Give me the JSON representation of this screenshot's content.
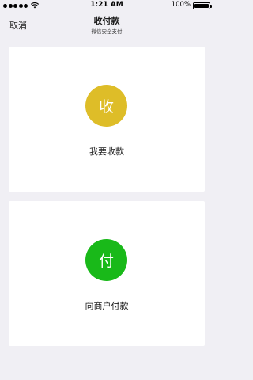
{
  "status_bar": {
    "time": "1:21 AM",
    "battery": "100%",
    "icons": [
      "signal-dots-icon",
      "wifi-icon",
      "battery-icon"
    ]
  },
  "nav": {
    "cancel_label": "取消",
    "title": "收付款",
    "subtitle": "微信安全支付"
  },
  "actions": [
    {
      "glyph": "收",
      "label": "我要收款",
      "color": "#debd28"
    },
    {
      "glyph": "付",
      "label": "向商户付款",
      "color": "#19b919"
    }
  ]
}
